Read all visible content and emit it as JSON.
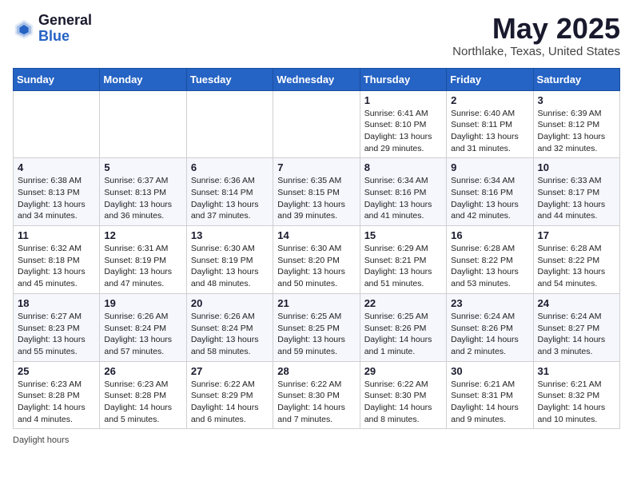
{
  "header": {
    "logo_general": "General",
    "logo_blue": "Blue",
    "month_year": "May 2025",
    "location": "Northlake, Texas, United States"
  },
  "days_of_week": [
    "Sunday",
    "Monday",
    "Tuesday",
    "Wednesday",
    "Thursday",
    "Friday",
    "Saturday"
  ],
  "weeks": [
    [
      {
        "num": "",
        "info": ""
      },
      {
        "num": "",
        "info": ""
      },
      {
        "num": "",
        "info": ""
      },
      {
        "num": "",
        "info": ""
      },
      {
        "num": "1",
        "info": "Sunrise: 6:41 AM\nSunset: 8:10 PM\nDaylight: 13 hours and 29 minutes."
      },
      {
        "num": "2",
        "info": "Sunrise: 6:40 AM\nSunset: 8:11 PM\nDaylight: 13 hours and 31 minutes."
      },
      {
        "num": "3",
        "info": "Sunrise: 6:39 AM\nSunset: 8:12 PM\nDaylight: 13 hours and 32 minutes."
      }
    ],
    [
      {
        "num": "4",
        "info": "Sunrise: 6:38 AM\nSunset: 8:13 PM\nDaylight: 13 hours and 34 minutes."
      },
      {
        "num": "5",
        "info": "Sunrise: 6:37 AM\nSunset: 8:13 PM\nDaylight: 13 hours and 36 minutes."
      },
      {
        "num": "6",
        "info": "Sunrise: 6:36 AM\nSunset: 8:14 PM\nDaylight: 13 hours and 37 minutes."
      },
      {
        "num": "7",
        "info": "Sunrise: 6:35 AM\nSunset: 8:15 PM\nDaylight: 13 hours and 39 minutes."
      },
      {
        "num": "8",
        "info": "Sunrise: 6:34 AM\nSunset: 8:16 PM\nDaylight: 13 hours and 41 minutes."
      },
      {
        "num": "9",
        "info": "Sunrise: 6:34 AM\nSunset: 8:16 PM\nDaylight: 13 hours and 42 minutes."
      },
      {
        "num": "10",
        "info": "Sunrise: 6:33 AM\nSunset: 8:17 PM\nDaylight: 13 hours and 44 minutes."
      }
    ],
    [
      {
        "num": "11",
        "info": "Sunrise: 6:32 AM\nSunset: 8:18 PM\nDaylight: 13 hours and 45 minutes."
      },
      {
        "num": "12",
        "info": "Sunrise: 6:31 AM\nSunset: 8:19 PM\nDaylight: 13 hours and 47 minutes."
      },
      {
        "num": "13",
        "info": "Sunrise: 6:30 AM\nSunset: 8:19 PM\nDaylight: 13 hours and 48 minutes."
      },
      {
        "num": "14",
        "info": "Sunrise: 6:30 AM\nSunset: 8:20 PM\nDaylight: 13 hours and 50 minutes."
      },
      {
        "num": "15",
        "info": "Sunrise: 6:29 AM\nSunset: 8:21 PM\nDaylight: 13 hours and 51 minutes."
      },
      {
        "num": "16",
        "info": "Sunrise: 6:28 AM\nSunset: 8:22 PM\nDaylight: 13 hours and 53 minutes."
      },
      {
        "num": "17",
        "info": "Sunrise: 6:28 AM\nSunset: 8:22 PM\nDaylight: 13 hours and 54 minutes."
      }
    ],
    [
      {
        "num": "18",
        "info": "Sunrise: 6:27 AM\nSunset: 8:23 PM\nDaylight: 13 hours and 55 minutes."
      },
      {
        "num": "19",
        "info": "Sunrise: 6:26 AM\nSunset: 8:24 PM\nDaylight: 13 hours and 57 minutes."
      },
      {
        "num": "20",
        "info": "Sunrise: 6:26 AM\nSunset: 8:24 PM\nDaylight: 13 hours and 58 minutes."
      },
      {
        "num": "21",
        "info": "Sunrise: 6:25 AM\nSunset: 8:25 PM\nDaylight: 13 hours and 59 minutes."
      },
      {
        "num": "22",
        "info": "Sunrise: 6:25 AM\nSunset: 8:26 PM\nDaylight: 14 hours and 1 minute."
      },
      {
        "num": "23",
        "info": "Sunrise: 6:24 AM\nSunset: 8:26 PM\nDaylight: 14 hours and 2 minutes."
      },
      {
        "num": "24",
        "info": "Sunrise: 6:24 AM\nSunset: 8:27 PM\nDaylight: 14 hours and 3 minutes."
      }
    ],
    [
      {
        "num": "25",
        "info": "Sunrise: 6:23 AM\nSunset: 8:28 PM\nDaylight: 14 hours and 4 minutes."
      },
      {
        "num": "26",
        "info": "Sunrise: 6:23 AM\nSunset: 8:28 PM\nDaylight: 14 hours and 5 minutes."
      },
      {
        "num": "27",
        "info": "Sunrise: 6:22 AM\nSunset: 8:29 PM\nDaylight: 14 hours and 6 minutes."
      },
      {
        "num": "28",
        "info": "Sunrise: 6:22 AM\nSunset: 8:30 PM\nDaylight: 14 hours and 7 minutes."
      },
      {
        "num": "29",
        "info": "Sunrise: 6:22 AM\nSunset: 8:30 PM\nDaylight: 14 hours and 8 minutes."
      },
      {
        "num": "30",
        "info": "Sunrise: 6:21 AM\nSunset: 8:31 PM\nDaylight: 14 hours and 9 minutes."
      },
      {
        "num": "31",
        "info": "Sunrise: 6:21 AM\nSunset: 8:32 PM\nDaylight: 14 hours and 10 minutes."
      }
    ]
  ],
  "footer": {
    "daylight_hours": "Daylight hours"
  }
}
